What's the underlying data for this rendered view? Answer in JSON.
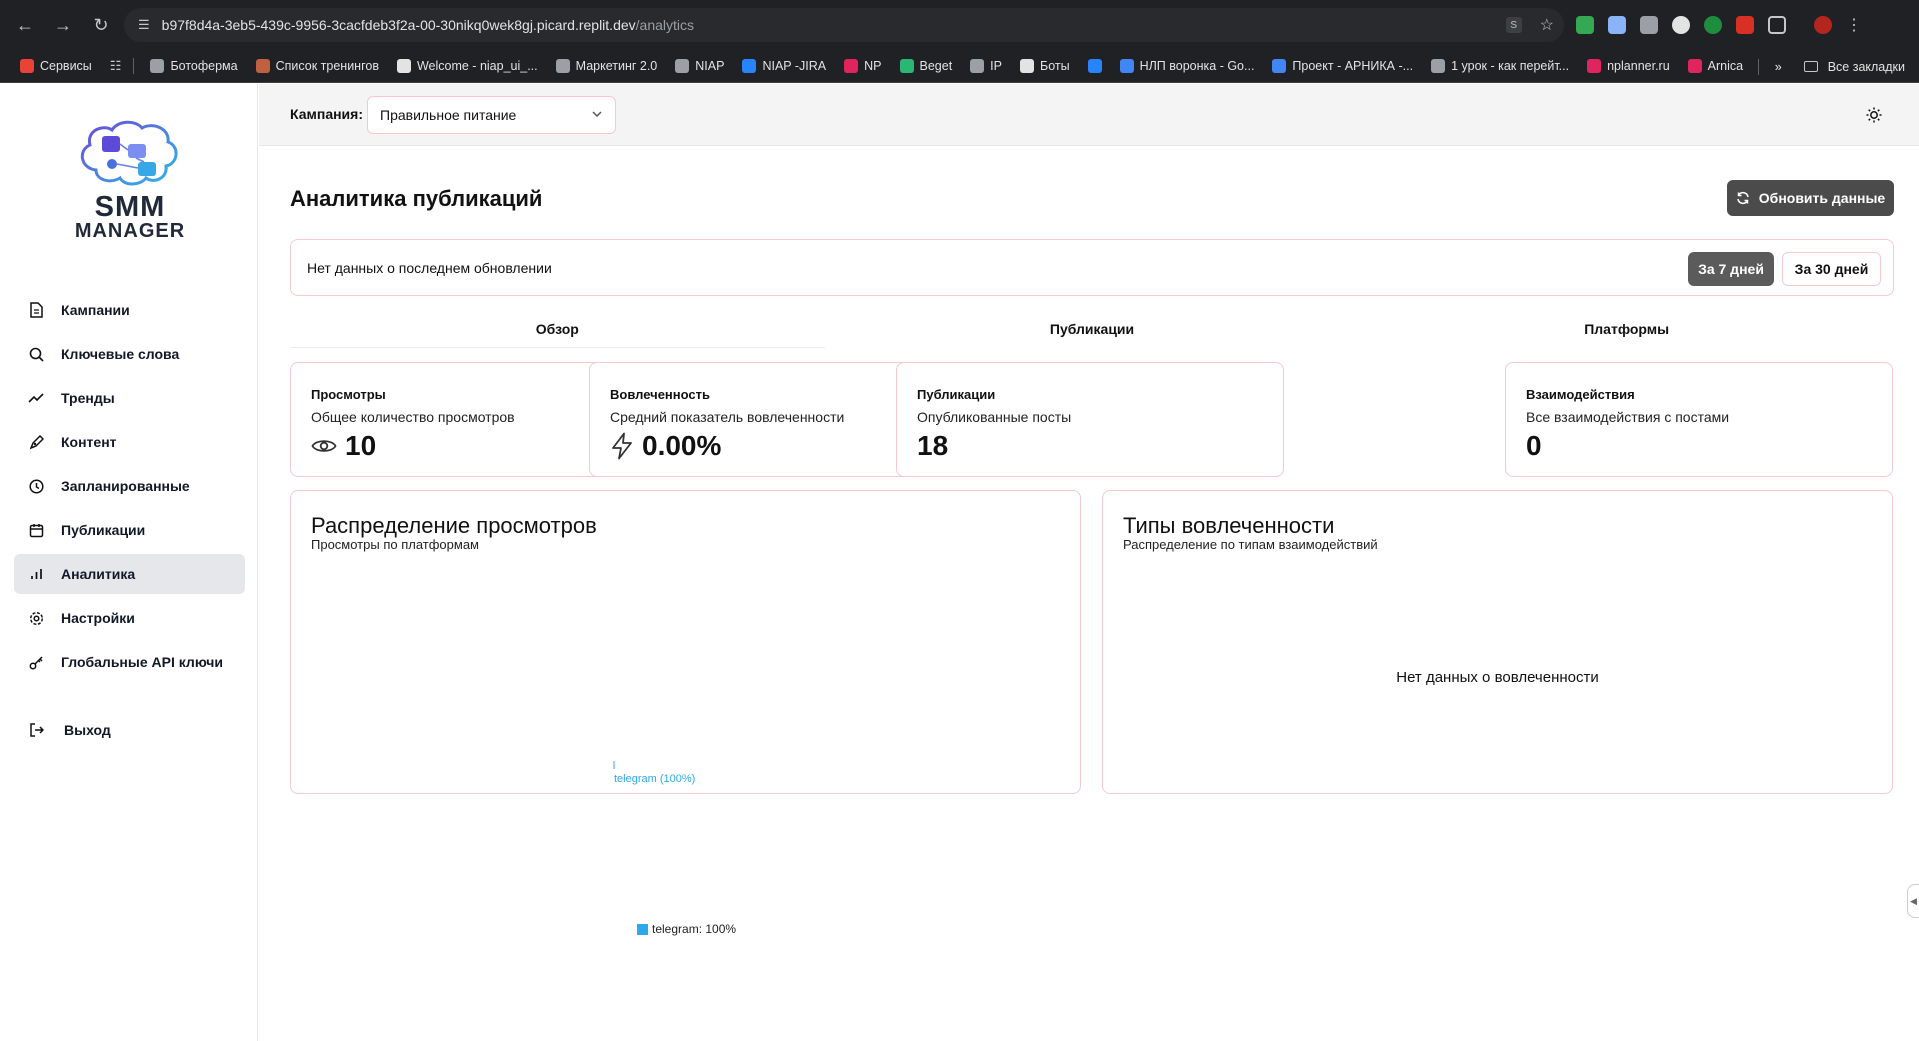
{
  "browser": {
    "url_host": "b97f8d4a-3eb5-439c-9956-3cacfdeb3f2a-00-30nikq0wek8gj.picard.replit.dev",
    "url_path": "/analytics",
    "s_badge": "S",
    "bookmarks": [
      {
        "label": "Сервисы",
        "color": "#ea4335"
      },
      {
        "label": "Ботоферма",
        "color": "#9aa0a6"
      },
      {
        "label": "Список тренингов",
        "color": "#c06040"
      },
      {
        "label": "Welcome - niap_ui_...",
        "color": "#e3e3e3"
      },
      {
        "label": "Маркетинг 2.0",
        "color": "#9aa0a6"
      },
      {
        "label": "NIAP",
        "color": "#9aa0a6"
      },
      {
        "label": "NIAP -JIRA",
        "color": "#2684ff"
      },
      {
        "label": "NP",
        "color": "#e0245e"
      },
      {
        "label": "Beget",
        "color": "#2bb673"
      },
      {
        "label": "IP",
        "color": "#9aa0a6"
      },
      {
        "label": "Боты",
        "color": "#e3e3e3"
      },
      {
        "label": "",
        "color": "#2684ff"
      },
      {
        "label": "НЛП воронка - Go...",
        "color": "#4285f4"
      },
      {
        "label": "Проект - АРНИКА -...",
        "color": "#4285f4"
      },
      {
        "label": "1 урок - как перейт...",
        "color": "#9aa0a6"
      },
      {
        "label": "nplanner.ru",
        "color": "#e0245e"
      },
      {
        "label": "Arnica",
        "color": "#e0245e"
      }
    ],
    "all_bookmarks": "Все закладки",
    "more": "»"
  },
  "logo": {
    "line1": "SMM",
    "line2": "MANAGER"
  },
  "sidebar": {
    "items": [
      {
        "label": "Кампании",
        "icon": "file-icon"
      },
      {
        "label": "Ключевые слова",
        "icon": "search-icon"
      },
      {
        "label": "Тренды",
        "icon": "trend-icon"
      },
      {
        "label": "Контент",
        "icon": "pen-icon"
      },
      {
        "label": "Запланированные",
        "icon": "clock-icon"
      },
      {
        "label": "Публикации",
        "icon": "calendar-icon"
      },
      {
        "label": "Аналитика",
        "icon": "bar-chart-icon"
      },
      {
        "label": "Настройки",
        "icon": "gear-icon"
      },
      {
        "label": "Глобальные API ключи",
        "icon": "key-icon"
      }
    ],
    "logout": "Выход"
  },
  "topbar": {
    "campaign_label": "Кампания:",
    "campaign_value": "Правильное питание"
  },
  "page": {
    "title": "Аналитика публикаций",
    "refresh_label": "Обновить данные",
    "status_text": "Нет данных о последнем обновлении",
    "period_7": "За 7 дней",
    "period_30": "За 30 дней",
    "tabs": [
      "Обзор",
      "Публикации",
      "Платформы"
    ]
  },
  "metrics": [
    {
      "title": "Просмотры",
      "subtitle": "Общее количество просмотров",
      "value": "10",
      "icon": "eye-icon"
    },
    {
      "title": "Вовлеченность",
      "subtitle": "Средний показатель вовлеченности",
      "value": "0.00%",
      "icon": "lightning-icon"
    },
    {
      "title": "Публикации",
      "subtitle": "Опубликованные посты",
      "value": "18",
      "icon": ""
    },
    {
      "title": "Взаимодействия",
      "subtitle": "Все взаимодействия с постами",
      "value": "0",
      "icon": ""
    }
  ],
  "charts": {
    "views": {
      "title": "Распределение просмотров",
      "subtitle": "Просмотры по платформам",
      "slice_label": "telegram (100%)",
      "legend": "telegram: 100%"
    },
    "engagement": {
      "title": "Типы вовлеченности",
      "subtitle": "Распределение по типам взаимодействий",
      "empty": "Нет данных о вовлеченности"
    }
  },
  "chart_data": {
    "type": "pie",
    "categories": [
      "telegram"
    ],
    "values": [
      100
    ],
    "title": "Распределение просмотров",
    "legend": "bottom"
  },
  "colors": {
    "accent_border": "#f3c9d2",
    "slice": "#2ea8e8",
    "active_button": "#5b5b5b"
  }
}
